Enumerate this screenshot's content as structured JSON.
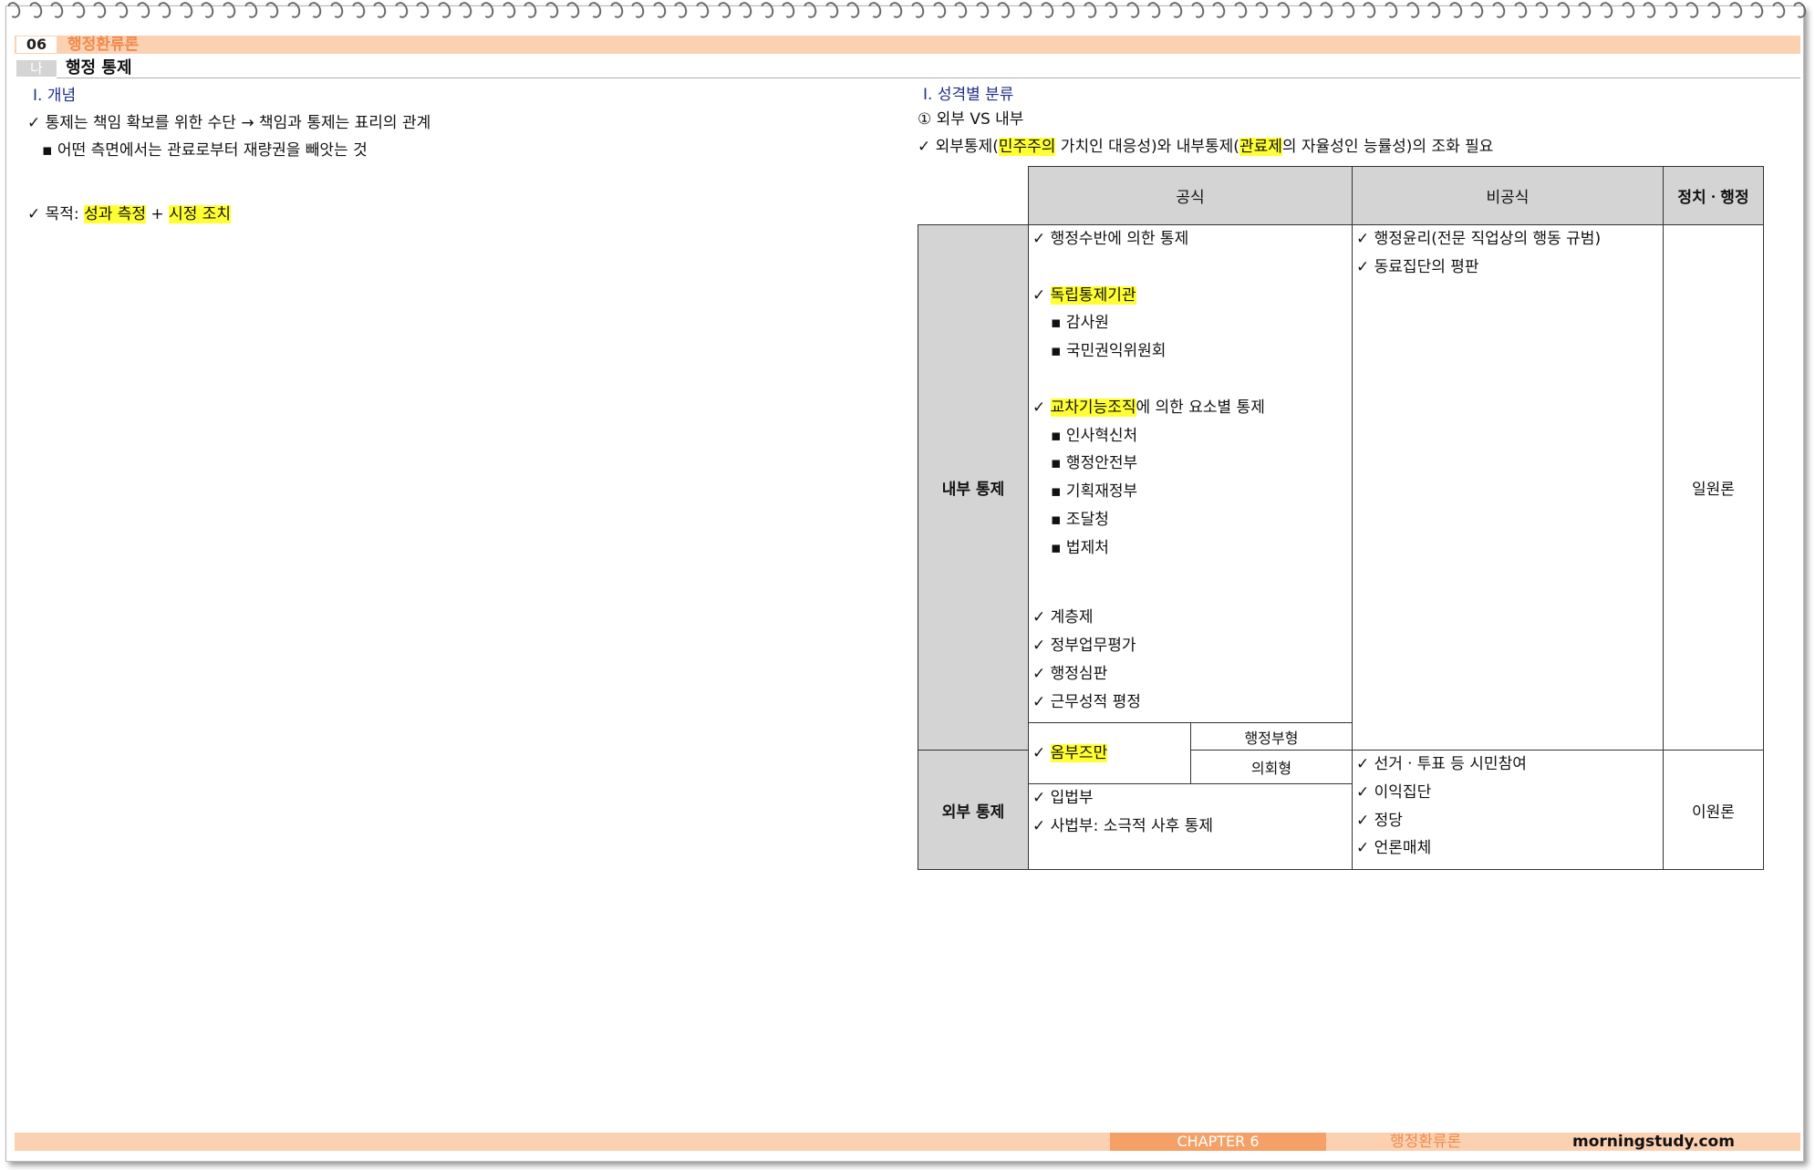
{
  "header": {
    "number": "06",
    "title": "행정환류론",
    "sub_badge": "나",
    "sub_title": "행정 통제"
  },
  "left": {
    "heading": "Ⅰ. 개념",
    "line1": "✓ 통제는 책임 확보를 위한 수단 →  책임과 통제는 표리의 관계",
    "line2": "▪ 어떤 측면에서는 관료로부터 재량권을 빼앗는 것",
    "purpose_prefix": "✓ 목적: ",
    "purpose_a": "성과 측정",
    "purpose_plus": " + ",
    "purpose_b": "시정 조치"
  },
  "right": {
    "heading": "Ⅰ. 성격별 분류",
    "sub": "① 외부 VS 내부",
    "line_a": "✓ 외부통제(",
    "line_hl1": "민주주의",
    "line_b": " 가치인 대응성)와 내부통제(",
    "line_hl2": "관료제",
    "line_c": "의 자율성인 능률성)의 조화 필요"
  },
  "table": {
    "col_formal": "공식",
    "col_informal": "비공식",
    "col_politics": "정치ㆍ행정",
    "row_internal": "내부 통제",
    "row_external": "외부 통제",
    "int_formal": {
      "a": "✓ 행정수반에 의한 통제",
      "b_check": "✓ ",
      "b_hl": "독립통제기관",
      "b1": "▪ 감사원",
      "b2": "▪ 국민권익위원회",
      "c_check": "✓ ",
      "c_hl": "교차기능조직",
      "c_rest": "에 의한 요소별 통제",
      "c1": "▪ 인사혁신처",
      "c2": "▪ 행정안전부",
      "c3": "▪ 기획재정부",
      "c4": "▪ 조달청",
      "c5": "▪ 법제처",
      "d1": "✓ 계층제",
      "d2": "✓ 정부업무평가",
      "d3": "✓ 행정심판",
      "d4": "✓ 근무성적 평정"
    },
    "int_informal": {
      "a": "✓ 행정윤리(전문 직업상의 행동 규범)",
      "b": "✓ 동료집단의 평판"
    },
    "int_politics": "일원론",
    "ombuds_check": "✓ ",
    "ombuds_hl": "옴부즈만",
    "ombuds_type1": "행정부형",
    "ombuds_type2": "의회형",
    "ext_formal": {
      "a": "✓ 입법부",
      "b": "✓ 사법부: 소극적 사후 통제"
    },
    "ext_informal": {
      "a": "✓ 선거ㆍ투표 등 시민참여",
      "b": "✓ 이익집단",
      "c": "✓ 정당",
      "d": "✓ 언론매체"
    },
    "ext_politics": "이원론"
  },
  "footer": {
    "chapter": "CHAPTER  6",
    "title": "행정환류론",
    "site": "morningstudy.com"
  }
}
